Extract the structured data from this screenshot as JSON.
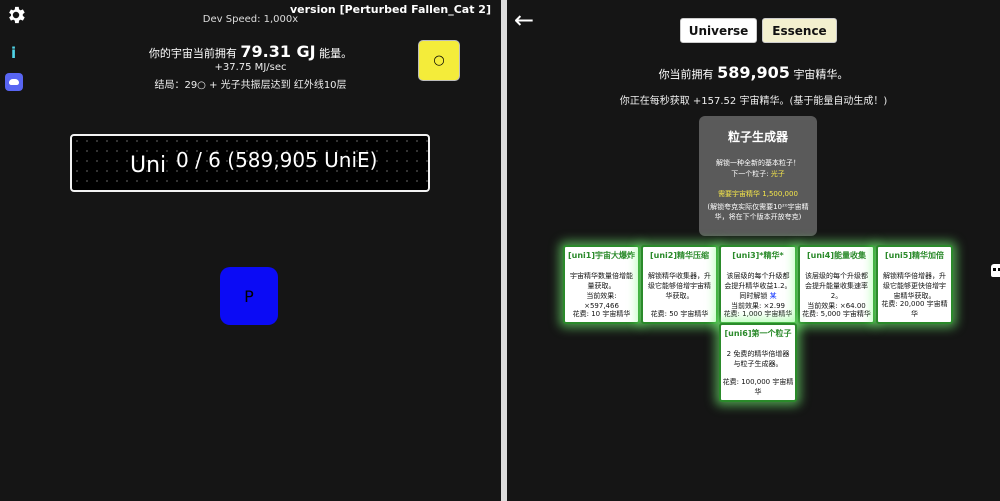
{
  "left": {
    "version": "version [Perturbed Fallen_Cat 2]",
    "dev_speed": "Dev Speed: 1,000x",
    "energy_prefix": "你的宇宙当前拥有",
    "energy_value": "79.31 GJ",
    "energy_suffix": "能量。",
    "rate": "+37.75 MJ/sec",
    "ending": "结局：29○ + 光子共振层达到 红外线10层",
    "yellow_button": "○",
    "uni_label": "Uni",
    "uni_progress": "0 / 6 (589,905 UniE)",
    "p_button": "P",
    "info_icon": "i"
  },
  "right": {
    "back": "←",
    "tabs": [
      "Universe",
      "Essence"
    ],
    "essence_prefix": "你当前拥有",
    "essence_value": "589,905",
    "essence_suffix": "宇宙精华。",
    "gain": "你正在每秒获取 +157.52 宇宙精华。(基于能量自动生成！)",
    "generator": {
      "title": "粒子生成器",
      "desc1": "解锁一种全新的基本粒子！",
      "desc2_prefix": "下一个粒子:",
      "desc2_value": "光子",
      "cost": "需要宇宙精华 1,500,000",
      "note": "(解锁夸克实际仅需要10²⁰宇宙精华，将在下个版本开放夸克)"
    },
    "cards": [
      {
        "title": "[uni1]宇宙大爆炸",
        "desc": "宇宙精华数量倍增能量获取。",
        "effect": "当前效果: ×597,466",
        "cost": "花费: 10 宇宙精华"
      },
      {
        "title": "[uni2]精华压缩",
        "desc": "解锁精华收集器，升级它能够倍增宇宙精华获取。",
        "effect": "",
        "cost": "花费: 50 宇宙精华"
      },
      {
        "title": "[uni3]*精华*",
        "desc": "该层级的每个升级都会提升精华收益1.2。同时解锁",
        "desc_hl": "某",
        "effect": "当前效果: ×2.99",
        "cost": "花费: 1,000 宇宙精华"
      },
      {
        "title": "[uni4]能量收集",
        "desc": "该层级的每个升级都会提升能量收集速率2。",
        "effect": "当前效果: ×64.00",
        "cost": "花费: 5,000 宇宙精华"
      },
      {
        "title": "[uni5]精华加倍",
        "desc": "解锁精华倍增器，升级它能够更快倍增宇宙精华获取。",
        "effect": "",
        "cost": "花费: 20,000 宇宙精华"
      },
      {
        "title": "[uni6]第一个粒子",
        "desc": "2 免费的精华倍增器与粒子生成器。",
        "effect": "",
        "cost": "花费: 100,000 宇宙精华"
      }
    ]
  },
  "colors": {
    "accent_yellow": "#f4ec3a",
    "card_border": "#2a8a2a",
    "p_button": "#0b0bf5"
  }
}
